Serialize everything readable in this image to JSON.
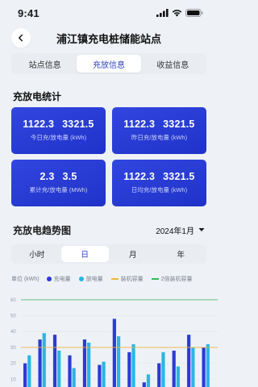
{
  "status": {
    "time": "9:41"
  },
  "header": {
    "title": "浦江镇充电桩储能站点"
  },
  "tabs": [
    {
      "label": "站点信息",
      "active": false
    },
    {
      "label": "充放信息",
      "active": true
    },
    {
      "label": "收益信息",
      "active": false
    }
  ],
  "stats": {
    "title": "充放电统计",
    "cards": [
      {
        "charge": "1122.3",
        "discharge": "3321.5",
        "label": "今日充/放电量 (kWh)"
      },
      {
        "charge": "1122.3",
        "discharge": "3321.5",
        "label": "昨日充/放电量 (kWh)"
      },
      {
        "charge": "2.3",
        "discharge": "3.5",
        "label": "累计充/放电量 (MWh)"
      },
      {
        "charge": "1122.3",
        "discharge": "3321.5",
        "label": "日均充/放电量 (kWh)"
      }
    ]
  },
  "trend": {
    "title": "充放电趋势图",
    "month": "2024年1月",
    "periods": [
      {
        "label": "小时",
        "active": false
      },
      {
        "label": "日",
        "active": true
      },
      {
        "label": "月",
        "active": false
      },
      {
        "label": "年",
        "active": false
      }
    ]
  },
  "legend": {
    "unit": "单位 (kWh)",
    "items": [
      {
        "label": "充电量",
        "color": "#2b3bd6",
        "shape": "dot"
      },
      {
        "label": "放电量",
        "color": "#29b6e6",
        "shape": "dot"
      },
      {
        "label": "装机容量",
        "color": "#f0b43c",
        "shape": "line"
      },
      {
        "label": "2倍装机容量",
        "color": "#35b85a",
        "shape": "line"
      }
    ]
  },
  "chart_data": {
    "type": "bar",
    "yticks": [
      "60",
      "50",
      "40",
      "30",
      "20",
      "10"
    ],
    "ylim": [
      0,
      65
    ],
    "series": [
      {
        "name": "充电量",
        "color": "#2b3bd6",
        "values": [
          20,
          35,
          38,
          25,
          35,
          19,
          48,
          27,
          8,
          20,
          28,
          38,
          30
        ]
      },
      {
        "name": "放电量",
        "color": "#29b6e6",
        "values": [
          25,
          39,
          28,
          17,
          33,
          21,
          37,
          32,
          13,
          27,
          18,
          30,
          32
        ]
      }
    ],
    "lines": [
      {
        "name": "装机容量",
        "color": "#f0b43c",
        "value": 30
      },
      {
        "name": "2倍装机容量",
        "color": "#35b85a",
        "value": 60
      }
    ]
  }
}
